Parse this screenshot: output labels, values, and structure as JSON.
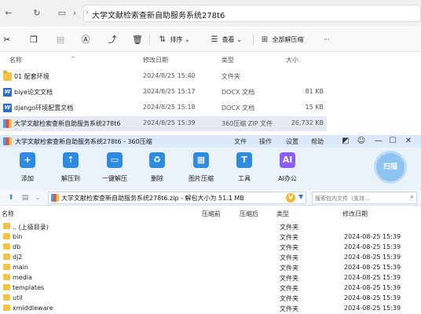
{
  "explorer": {
    "address_path": "大学文献检索查新自助服务系统278t6",
    "toolbar": {
      "sort_label": "排序",
      "view_label": "查看",
      "extract_all_label": "全部解压缩",
      "more_label": "···"
    },
    "columns": {
      "name": "名称",
      "modified": "修改日期",
      "type": "类型",
      "size": "大小"
    },
    "rows": [
      {
        "name": "01 配套环境",
        "modified": "2024/8/25 15:40",
        "type": "文件夹",
        "size": "",
        "icon": "folder-icon"
      },
      {
        "name": "biye论文文档",
        "modified": "2024/8/25 15:17",
        "type": "DOCX 文档",
        "size": "81 KB",
        "icon": "docx-icon"
      },
      {
        "name": "django环境配置文档",
        "modified": "2024/8/25 15:18",
        "type": "DOCX 文档",
        "size": "15 KB",
        "icon": "docx-icon"
      },
      {
        "name": "大学文献检索查新自助服务系统278t6",
        "modified": "2024/8/25 15:39",
        "type": "360压缩 ZIP 文件",
        "size": "26,732 KB",
        "icon": "zip-icon"
      }
    ]
  },
  "zip": {
    "title": "大学文献检索查新自助服务系统278t6 - 360压缩",
    "menus": [
      "文件",
      "操作",
      "设置",
      "帮助"
    ],
    "ribbon": [
      {
        "label": "添加",
        "icon": "add-icon",
        "glyph": "+",
        "color": "#2e8be0"
      },
      {
        "label": "解压到",
        "icon": "extract-to-icon",
        "glyph": "⇡",
        "color": "#2e8be0"
      },
      {
        "label": "一键解压",
        "icon": "one-click-extract-icon",
        "glyph": "▭",
        "color": "#2e8be0"
      },
      {
        "label": "删除",
        "icon": "delete-icon",
        "glyph": "♻",
        "color": "#2e8be0"
      },
      {
        "label": "图片压缩",
        "icon": "image-compress-icon",
        "glyph": "▦",
        "color": "#2e8be0"
      },
      {
        "label": "工具",
        "icon": "tools-icon",
        "glyph": "T",
        "color": "#2e8be0"
      },
      {
        "label": "AI办公",
        "icon": "ai-office-icon",
        "glyph": "AI",
        "color": "#8b5cf6"
      }
    ],
    "scan_label": "扫描",
    "path_text": "大学文献检索查新自助服务系统278t6.zip - 解包大小为 51.1 MB",
    "path_badge": "V",
    "search_placeholder": "搜索包内文件（支持...",
    "columns": {
      "name": "名称",
      "compressed": "压缩前",
      "packed": "压缩后",
      "type": "类型",
      "modified": "修改日期"
    },
    "rows": [
      {
        "name": ".. (上级目录)",
        "type": "文件夹",
        "modified": ""
      },
      {
        "name": "bin",
        "type": "文件夹",
        "modified": "2024-08-25 15:39"
      },
      {
        "name": "db",
        "type": "文件夹",
        "modified": "2024-08-25 15:39"
      },
      {
        "name": "dj2",
        "type": "文件夹",
        "modified": "2024-08-25 15:39"
      },
      {
        "name": "main",
        "type": "文件夹",
        "modified": "2024-08-25 15:39"
      },
      {
        "name": "media",
        "type": "文件夹",
        "modified": "2024-08-25 15:39"
      },
      {
        "name": "templates",
        "type": "文件夹",
        "modified": "2024-08-25 15:39"
      },
      {
        "name": "util",
        "type": "文件夹",
        "modified": "2024-08-25 15:39"
      },
      {
        "name": "xmiddleware",
        "type": "文件夹",
        "modified": "2024-08-25 15:39"
      }
    ]
  }
}
